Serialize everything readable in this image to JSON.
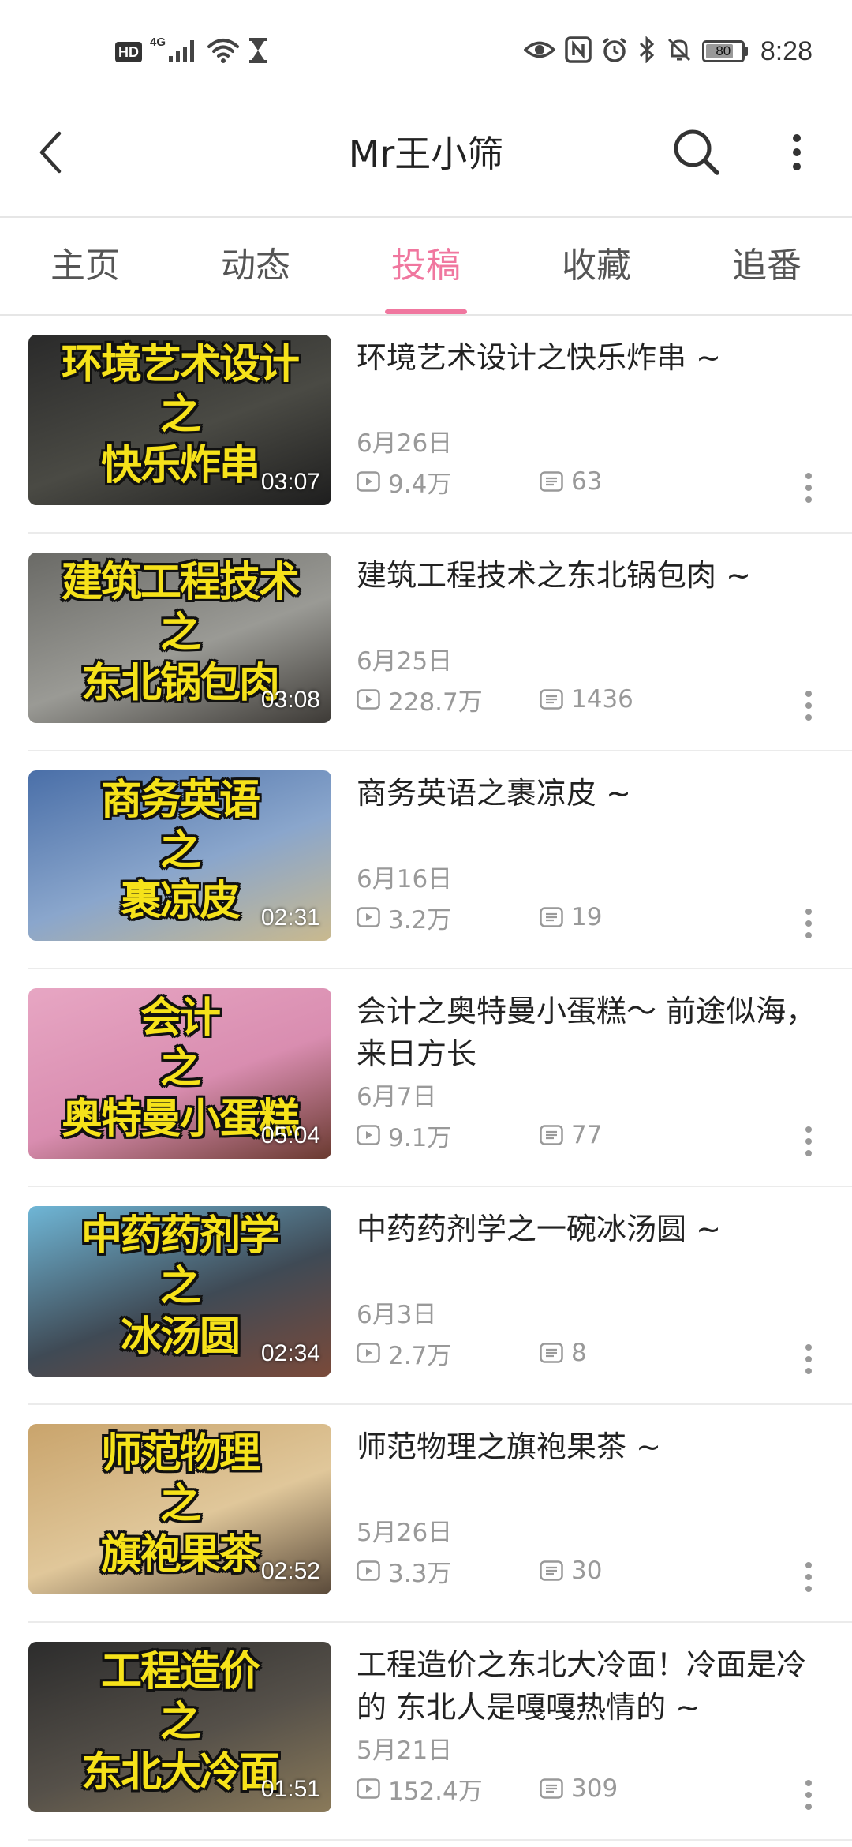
{
  "status_bar": {
    "hd": "HD",
    "network": "4G",
    "battery": "80",
    "battery_level": 0.8,
    "time": "8:28",
    "icons_left": [
      "hd-badge",
      "signal-icon",
      "wifi-icon",
      "hourglass-icon"
    ],
    "icons_right": [
      "eye-icon",
      "nfc-icon",
      "alarm-icon",
      "bluetooth-icon",
      "mute-icon",
      "battery-icon"
    ]
  },
  "header": {
    "title": "Mr王小筛",
    "back_icon": "chevron-left-icon",
    "search_icon": "search-icon",
    "more_icon": "more-vertical-icon"
  },
  "tabs": [
    {
      "label": "主页",
      "active": false
    },
    {
      "label": "动态",
      "active": false
    },
    {
      "label": "投稿",
      "active": true
    },
    {
      "label": "收藏",
      "active": false
    },
    {
      "label": "追番",
      "active": false
    }
  ],
  "colors": {
    "accent": "#f0779f",
    "caption_yellow": "#f6e21a",
    "meta_gray": "#999999"
  },
  "videos": [
    {
      "thumb_text": "环境艺术设计\n之\n快乐炸串",
      "duration": "03:07",
      "title": "环境艺术设计之快乐炸串 ~",
      "date": "6月26日",
      "views": "9.4万",
      "danmaku": "63",
      "thumb_bg": [
        "#2a2a2a",
        "#4a4a44",
        "#1e1e1e"
      ]
    },
    {
      "thumb_text": "建筑工程技术\n之\n东北锅包肉",
      "duration": "03:08",
      "title": "建筑工程技术之东北锅包肉 ~",
      "date": "6月25日",
      "views": "228.7万",
      "danmaku": "1436",
      "thumb_bg": [
        "#6a6a66",
        "#9a9a95",
        "#3d3a36"
      ]
    },
    {
      "thumb_text": "商务英语\n之\n裹凉皮",
      "duration": "02:31",
      "title": "商务英语之裹凉皮 ~",
      "date": "6月16日",
      "views": "3.2万",
      "danmaku": "19",
      "thumb_bg": [
        "#4a6fa8",
        "#8aa6cc",
        "#c9b98e"
      ]
    },
    {
      "thumb_text": "会计\n之\n奥特曼小蛋糕",
      "duration": "05:04",
      "title": "会计之奥特曼小蛋糕～ 前途似海，来日方长",
      "date": "6月7日",
      "views": "9.1万",
      "danmaku": "77",
      "thumb_bg": [
        "#e7a6c3",
        "#d98db0",
        "#6a3a30"
      ]
    },
    {
      "thumb_text": "中药药剂学\n之\n冰汤圆",
      "duration": "02:34",
      "title": "中药药剂学之一碗冰汤圆 ~",
      "date": "6月3日",
      "views": "2.7万",
      "danmaku": "8",
      "thumb_bg": [
        "#6fb6d6",
        "#3f4a55",
        "#7a4a3a"
      ]
    },
    {
      "thumb_text": "师范物理\n之\n旗袍果茶",
      "duration": "02:52",
      "title": "师范物理之旗袍果茶 ~",
      "date": "5月26日",
      "views": "3.3万",
      "danmaku": "30",
      "thumb_bg": [
        "#c9a46c",
        "#e0c79a",
        "#5a4a3a"
      ]
    },
    {
      "thumb_text": "工程造价\n之\n东北大冷面",
      "duration": "01:51",
      "title": "工程造价之东北大冷面！冷面是冷的 东北人是嘎嘎热情的 ~",
      "date": "5月21日",
      "views": "152.4万",
      "danmaku": "309",
      "thumb_bg": [
        "#2c2c2c",
        "#555049",
        "#8a7a5a"
      ]
    }
  ]
}
